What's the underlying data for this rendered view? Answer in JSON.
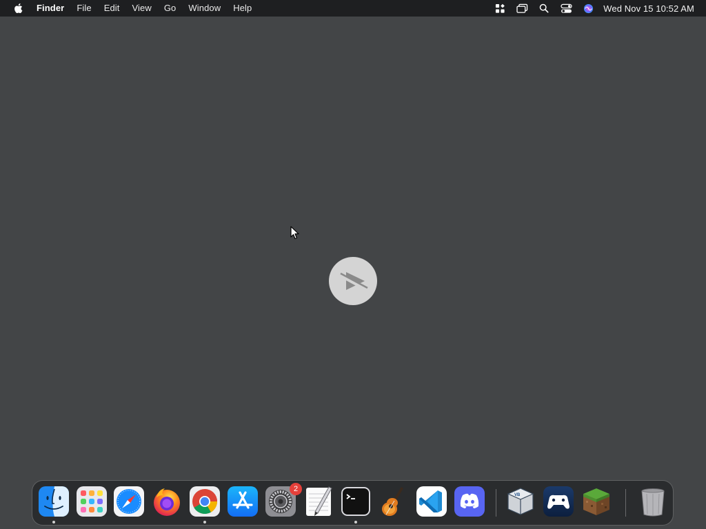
{
  "menubar": {
    "apple_icon": "apple-logo-icon",
    "app_name": "Finder",
    "items": [
      "File",
      "Edit",
      "View",
      "Go",
      "Window",
      "Help"
    ],
    "status_icons": [
      "control-center-widgets-icon",
      "screen-mirroring-icon",
      "spotlight-search-icon",
      "control-center-toggle-icon",
      "siri-icon"
    ],
    "clock": "Wed Nov 15  10:52 AM"
  },
  "desktop": {
    "overlay_icon": "media-play-disabled-icon",
    "cursor": "arrow-cursor-icon"
  },
  "dock": {
    "apps": [
      {
        "name": "Finder",
        "icon": "finder-icon",
        "running": true
      },
      {
        "name": "Launchpad",
        "icon": "launchpad-icon",
        "running": false
      },
      {
        "name": "Safari",
        "icon": "safari-icon",
        "running": false
      },
      {
        "name": "Firefox",
        "icon": "firefox-icon",
        "running": false
      },
      {
        "name": "Google Chrome",
        "icon": "chrome-icon",
        "running": true
      },
      {
        "name": "App Store",
        "icon": "app-store-icon",
        "running": false
      },
      {
        "name": "System Settings",
        "icon": "system-settings-icon",
        "running": false,
        "badge": "2"
      },
      {
        "name": "TextEdit",
        "icon": "textedit-icon",
        "running": false
      },
      {
        "name": "Terminal",
        "icon": "terminal-icon",
        "running": true
      },
      {
        "name": "GarageBand",
        "icon": "garageband-icon",
        "running": false
      },
      {
        "name": "Visual Studio Code",
        "icon": "vscode-icon",
        "running": false
      },
      {
        "name": "Discord",
        "icon": "discord-icon",
        "running": false
      },
      {
        "name": "VirtualBox",
        "icon": "virtualbox-icon",
        "running": false
      },
      {
        "name": "Steam Link",
        "icon": "gamepad-app-icon",
        "running": false
      },
      {
        "name": "Minecraft",
        "icon": "minecraft-icon",
        "running": false
      },
      {
        "name": "Trash",
        "icon": "trash-icon",
        "running": false
      }
    ]
  }
}
